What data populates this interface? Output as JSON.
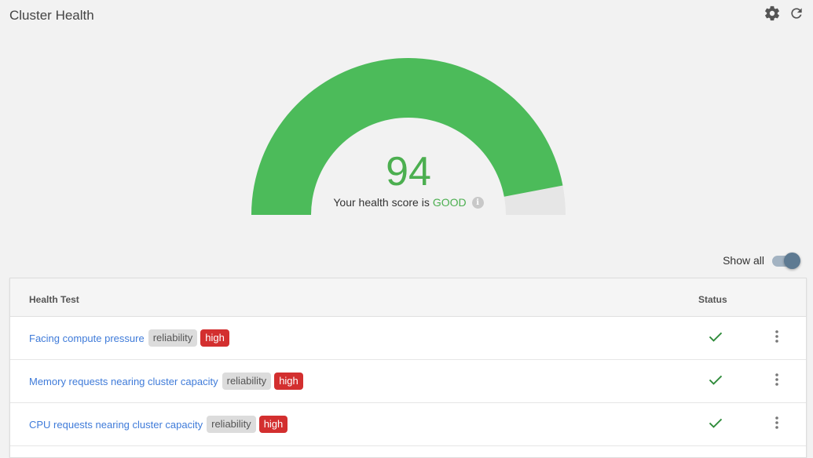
{
  "header": {
    "title": "Cluster Health",
    "icons": {
      "settings": "gear-icon",
      "refresh": "refresh-icon"
    }
  },
  "gauge": {
    "score": "94",
    "score_value": 94,
    "max": 100,
    "caption_prefix": "Your health score is",
    "status": "GOOD",
    "info_glyph": "i",
    "colors": {
      "fill": "#4cbb5a",
      "track": "#e6e6e6",
      "text": "#4caf50"
    }
  },
  "filter": {
    "show_all_label": "Show all",
    "show_all_on": true
  },
  "table": {
    "columns": {
      "name": "Health Test",
      "status": "Status"
    },
    "rows": [
      {
        "name": "Facing compute pressure",
        "category": "reliability",
        "severity": "high",
        "status": "passed"
      },
      {
        "name": "Memory requests nearing cluster capacity",
        "category": "reliability",
        "severity": "high",
        "status": "passed"
      },
      {
        "name": "CPU requests nearing cluster capacity",
        "category": "reliability",
        "severity": "high",
        "status": "passed"
      }
    ]
  },
  "colors": {
    "link": "#3f7bd9",
    "severity_high": "#d32f2f",
    "check": "#2e8b3a"
  }
}
